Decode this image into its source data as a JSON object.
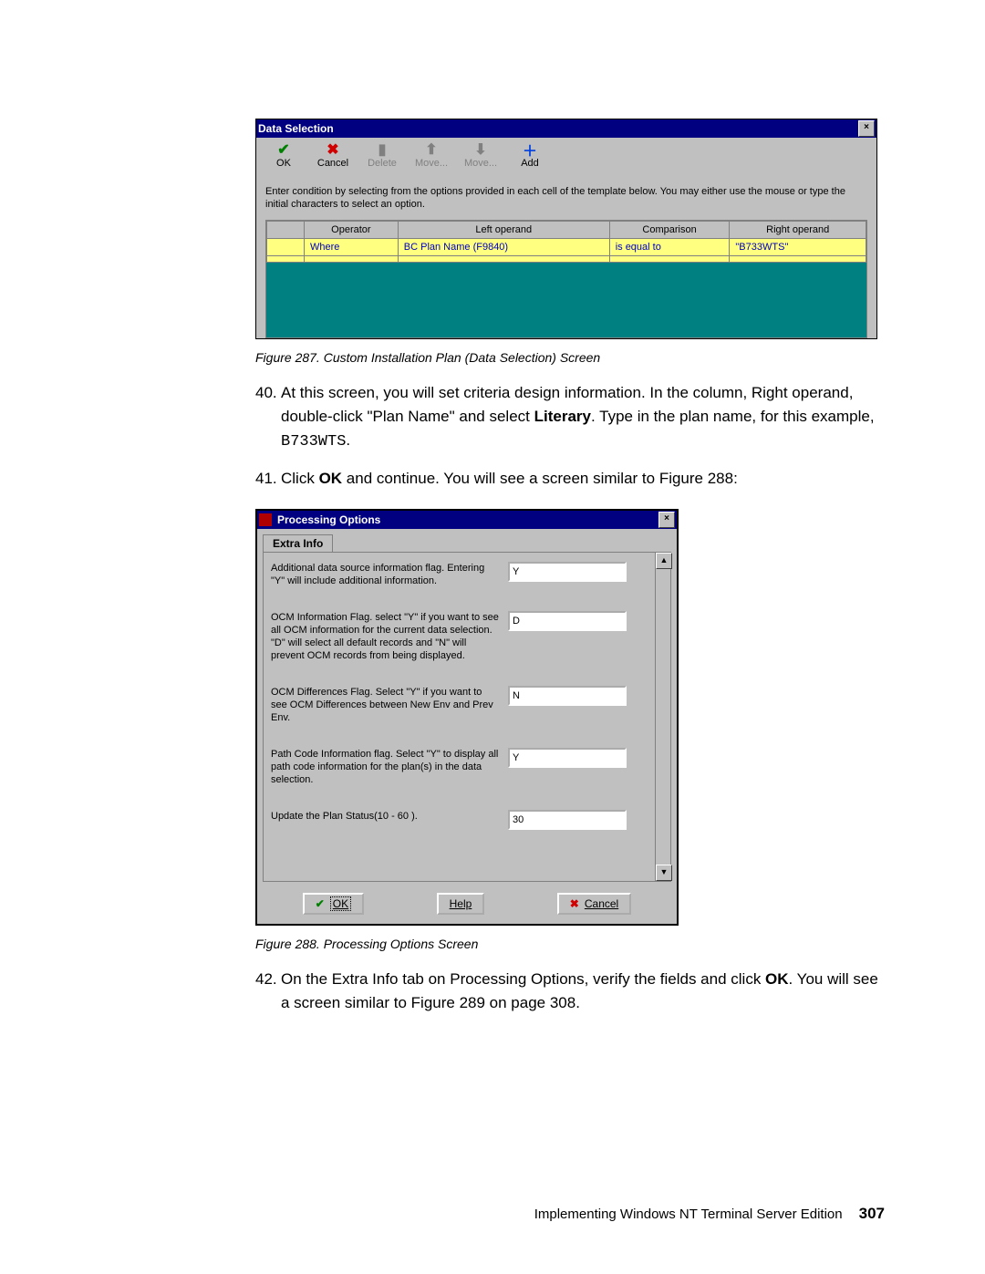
{
  "figure287": {
    "window_title": "Data Selection",
    "toolbar": [
      {
        "icon": "check",
        "label": "OK",
        "enabled": true
      },
      {
        "icon": "x",
        "label": "Cancel",
        "enabled": true
      },
      {
        "icon": "trash",
        "label": "Delete",
        "enabled": false
      },
      {
        "icon": "up",
        "label": "Move...",
        "enabled": false
      },
      {
        "icon": "dn",
        "label": "Move...",
        "enabled": false
      },
      {
        "icon": "plus",
        "label": "Add",
        "enabled": true
      }
    ],
    "hint": "Enter condition by selecting from the options provided in each cell of the template below. You may either use the mouse or type the initial characters to select an option.",
    "columns": [
      "Operator",
      "Left operand",
      "Comparison",
      "Right operand"
    ],
    "rows": [
      {
        "operator": "Where",
        "left": "BC Plan Name (F9840)",
        "comparison": "is equal to",
        "right": "\"B733WTS\""
      }
    ],
    "caption": "Figure 287. Custom Installation Plan (Data Selection) Screen"
  },
  "step40": {
    "num": "40.",
    "text_a": "At this screen, you will set criteria design information. In the column, Right operand, double-click \"Plan Name\" and select ",
    "bold": "Literary",
    "text_b": ". Type in the plan name, for this example, ",
    "mono": "B733WTS",
    "text_c": "."
  },
  "step41": {
    "num": "41.",
    "text_a": "Click ",
    "bold": "OK",
    "text_b": " and continue. You will see a screen similar to Figure 288:"
  },
  "figure288": {
    "window_title": "Processing Options",
    "tab": "Extra Info",
    "options": [
      {
        "label": "Additional data source information flag. Entering \"Y\" will include additional information.",
        "value": "Y"
      },
      {
        "label": "OCM Information Flag.  select \"Y\" if you want to see all OCM information for the current data selection. \"D\" will select all default records and \"N\" will prevent OCM records from being displayed.",
        "value": "D"
      },
      {
        "label": "OCM Differences Flag. Select \"Y\" if you want to see OCM Differences between New Env and Prev Env.",
        "value": "N"
      },
      {
        "label": "Path Code Information flag.  Select \"Y\" to display all path code information for the plan(s) in the data selection.",
        "value": "Y"
      },
      {
        "label": "Update the Plan Status(10 - 60 ).",
        "value": "30"
      }
    ],
    "buttons": {
      "ok": "OK",
      "help": "Help",
      "cancel": "Cancel"
    },
    "caption": "Figure 288. Processing Options Screen"
  },
  "step42": {
    "num": "42.",
    "text_a": "On the Extra Info tab on Processing Options, verify the fields and click ",
    "bold": "OK",
    "text_b": ". You will see a screen similar to Figure 289 on page 308."
  },
  "footer": {
    "text": "Implementing Windows NT Terminal Server Edition",
    "page": "307"
  }
}
